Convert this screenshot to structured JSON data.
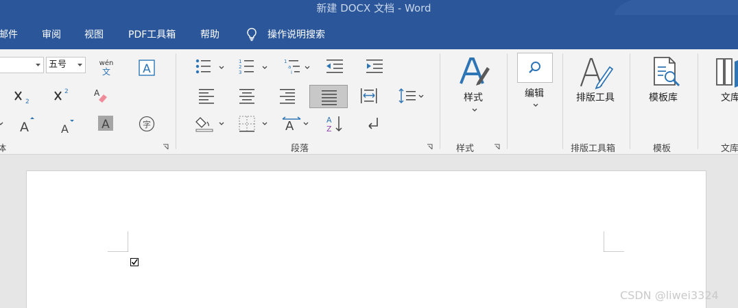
{
  "window": {
    "title": "新建 DOCX 文档  -  Word"
  },
  "menu": {
    "tabs": [
      "邮件",
      "审阅",
      "视图",
      "PDF工具箱",
      "帮助"
    ],
    "tell_me": "操作说明搜索"
  },
  "font_group": {
    "font_size": "五号",
    "label": "体"
  },
  "paragraph_group": {
    "label": "段落"
  },
  "styles_group": {
    "button_label": "样式",
    "label": "样式"
  },
  "editing": {
    "button_label": "编辑"
  },
  "layout_tools": {
    "button_label": "排版工具",
    "label": "排版工具箱"
  },
  "templates": {
    "button_label": "模板库",
    "label": "模板"
  },
  "library": {
    "button_label": "文库",
    "label": "文库"
  },
  "document": {
    "checkbox_mark": "☑"
  },
  "watermark": "CSDN @liwei3324",
  "colors": {
    "title_bar": "#2b579a",
    "ribbon": "#f3f3f3",
    "accent": "#2e75b6"
  }
}
